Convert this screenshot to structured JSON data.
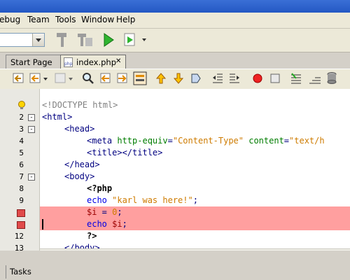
{
  "menu": [
    "ebug",
    "Team",
    "Tools",
    "Window",
    "Help"
  ],
  "tabs": [
    {
      "label": "Start Page",
      "active": false
    },
    {
      "label": "index.php",
      "active": true
    }
  ],
  "editor": {
    "lines": [
      {
        "num": "",
        "tokens": [
          {
            "c": "doctype",
            "t": "<!DOCTYPE html>"
          }
        ],
        "indent": 0,
        "marker": "bulb"
      },
      {
        "num": "2",
        "tokens": [
          {
            "c": "tag",
            "t": "<html>"
          }
        ],
        "indent": 0,
        "fold": "-"
      },
      {
        "num": "3",
        "tokens": [
          {
            "c": "tag",
            "t": "<head>"
          }
        ],
        "indent": 1,
        "fold": "-"
      },
      {
        "num": "4",
        "tokens": [
          {
            "c": "tag",
            "t": "<meta "
          },
          {
            "c": "attr",
            "t": "http-equiv"
          },
          {
            "c": "tag",
            "t": "="
          },
          {
            "c": "str",
            "t": "\"Content-Type\""
          },
          {
            "c": "attr",
            "t": " content"
          },
          {
            "c": "tag",
            "t": "="
          },
          {
            "c": "str",
            "t": "\"text/h"
          }
        ],
        "indent": 2
      },
      {
        "num": "5",
        "tokens": [
          {
            "c": "tag",
            "t": "<title></title>"
          }
        ],
        "indent": 2
      },
      {
        "num": "6",
        "tokens": [
          {
            "c": "tag",
            "t": "</head>"
          }
        ],
        "indent": 1
      },
      {
        "num": "7",
        "tokens": [
          {
            "c": "tag",
            "t": "<body>"
          }
        ],
        "indent": 1,
        "fold": "-"
      },
      {
        "num": "8",
        "tokens": [
          {
            "c": "php",
            "t": "<?php"
          }
        ],
        "indent": 2
      },
      {
        "num": "9",
        "tokens": [
          {
            "c": "kw",
            "t": "echo "
          },
          {
            "c": "str",
            "t": "\"karl was here!\""
          },
          {
            "c": "tag",
            "t": ";"
          }
        ],
        "indent": 2
      },
      {
        "num": "",
        "tokens": [
          {
            "c": "var",
            "t": "$i"
          },
          {
            "c": "tag",
            "t": " = "
          },
          {
            "c": "str",
            "t": "0"
          },
          {
            "c": "tag",
            "t": ";"
          }
        ],
        "indent": 2,
        "marker": "bp",
        "highlight": true
      },
      {
        "num": "",
        "tokens": [
          {
            "c": "kw",
            "t": "echo "
          },
          {
            "c": "var",
            "t": "$i"
          },
          {
            "c": "tag",
            "t": ";"
          }
        ],
        "indent": 2,
        "marker": "bp",
        "highlight": true
      },
      {
        "num": "12",
        "tokens": [
          {
            "c": "php",
            "t": "?>"
          }
        ],
        "indent": 2
      },
      {
        "num": "13",
        "tokens": [
          {
            "c": "tag",
            "t": "</body>"
          }
        ],
        "indent": 1
      }
    ]
  },
  "status": {
    "tasks_label": "Tasks"
  },
  "colors": {
    "highlight": "#ff9f9f",
    "breakpoint": "#e04a4a"
  }
}
